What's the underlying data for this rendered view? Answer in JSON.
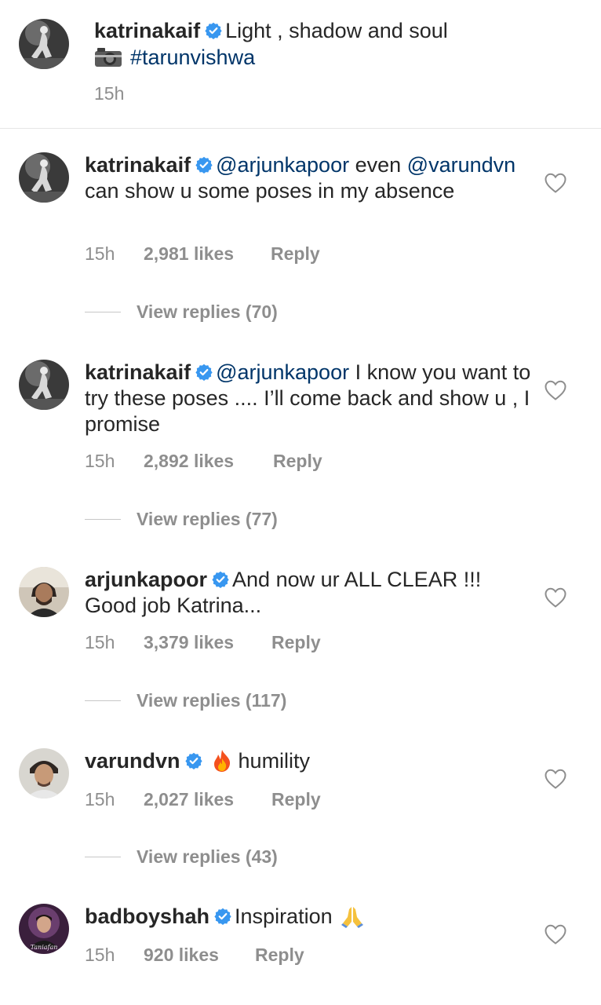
{
  "caption": {
    "username": "katrinakaif",
    "text": "Light , shadow and soul",
    "hashtag": "#tarunvishwa",
    "time": "15h",
    "camera_icon": "camera-icon"
  },
  "comments": [
    {
      "username": "katrinakaif",
      "mention": "@arjunkapoor",
      "text_a": " even",
      "mention2": "@varundvn",
      "text_b": " can show u some poses in my absence",
      "time": "15h",
      "likes": "2,981 likes",
      "reply": "Reply",
      "view_replies": "View replies (70)"
    },
    {
      "username": "katrinakaif",
      "mention": "@arjunkapoor",
      "text_a": " I know you want to try these poses .... I’ll come back and show u , I promise",
      "time": "15h",
      "likes": "2,892 likes",
      "reply": "Reply",
      "view_replies": "View replies (77)"
    },
    {
      "username": "arjunkapoor",
      "text_a": "And now ur ALL CLEAR !!! Good job Katrina...",
      "time": "15h",
      "likes": "3,379 likes",
      "reply": "Reply",
      "view_replies": "View replies (117)"
    },
    {
      "username": "varundvn",
      "emoji": "fire-emoji",
      "text_a": "humility",
      "time": "15h",
      "likes": "2,027 likes",
      "reply": "Reply",
      "view_replies": "View replies (43)"
    },
    {
      "username": "badboyshah",
      "text_a": "Inspiration",
      "emoji": "folded-hands-emoji",
      "time": "15h",
      "likes": "920 likes",
      "reply": "Reply"
    }
  ],
  "colors": {
    "verified": "#3897f0",
    "mention": "#003569",
    "secondary": "#8e8e8e"
  },
  "avatar_watermark": "Taniafan"
}
